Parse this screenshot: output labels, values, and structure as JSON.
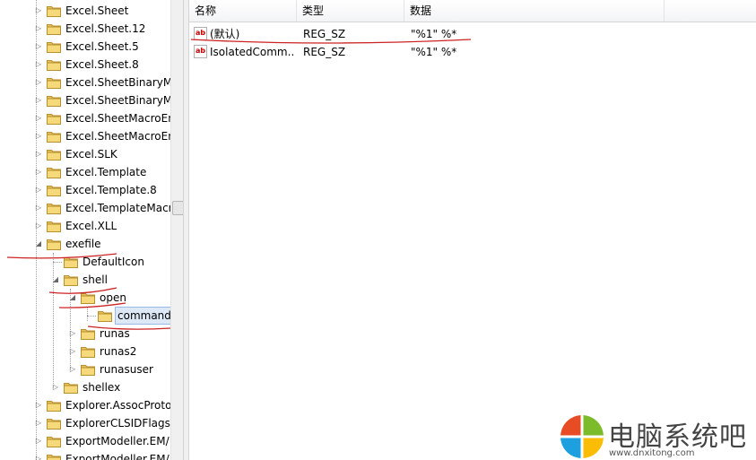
{
  "tree": {
    "items": [
      {
        "label": "Excel.Sheet",
        "level": 0,
        "expander": "closed"
      },
      {
        "label": "Excel.Sheet.12",
        "level": 0,
        "expander": "closed"
      },
      {
        "label": "Excel.Sheet.5",
        "level": 0,
        "expander": "closed"
      },
      {
        "label": "Excel.Sheet.8",
        "level": 0,
        "expander": "closed"
      },
      {
        "label": "Excel.SheetBinaryMa",
        "level": 0,
        "expander": "closed"
      },
      {
        "label": "Excel.SheetBinaryMa",
        "level": 0,
        "expander": "closed"
      },
      {
        "label": "Excel.SheetMacroEn",
        "level": 0,
        "expander": "closed"
      },
      {
        "label": "Excel.SheetMacroEn",
        "level": 0,
        "expander": "closed"
      },
      {
        "label": "Excel.SLK",
        "level": 0,
        "expander": "closed"
      },
      {
        "label": "Excel.Template",
        "level": 0,
        "expander": "closed"
      },
      {
        "label": "Excel.Template.8",
        "level": 0,
        "expander": "closed"
      },
      {
        "label": "Excel.TemplateMacr",
        "level": 0,
        "expander": "closed"
      },
      {
        "label": "Excel.XLL",
        "level": 0,
        "expander": "closed"
      },
      {
        "label": "exefile",
        "level": 0,
        "expander": "open"
      },
      {
        "label": "DefaultIcon",
        "level": 1,
        "expander": "none"
      },
      {
        "label": "shell",
        "level": 1,
        "expander": "open"
      },
      {
        "label": "open",
        "level": 2,
        "expander": "open"
      },
      {
        "label": "command",
        "level": 3,
        "expander": "none",
        "selected": true
      },
      {
        "label": "runas",
        "level": 2,
        "expander": "closed"
      },
      {
        "label": "runas2",
        "level": 2,
        "expander": "closed"
      },
      {
        "label": "runasuser",
        "level": 2,
        "expander": "closed"
      },
      {
        "label": "shellex",
        "level": 1,
        "expander": "closed"
      },
      {
        "label": "Explorer.AssocProto",
        "level": 0,
        "expander": "closed"
      },
      {
        "label": "ExplorerCLSIDFlags",
        "level": 0,
        "expander": "closed"
      },
      {
        "label": "ExportModeller.EM/",
        "level": 0,
        "expander": "closed"
      },
      {
        "label": "ExportModeller.EM/",
        "level": 0,
        "expander": "closed"
      }
    ]
  },
  "list": {
    "columns": [
      "名称",
      "类型",
      "数据"
    ],
    "rows": [
      {
        "name": "(默认)",
        "type": "REG_SZ",
        "data": "\"%1\" %*"
      },
      {
        "name": "IsolatedComm...",
        "type": "REG_SZ",
        "data": "\"%1\" %*"
      }
    ]
  },
  "watermark": {
    "brand": "电脑系统吧",
    "url": "www.dnxitong.com"
  },
  "colors": {
    "annotation_red": "#cc2222",
    "folder_yellow": "#e8c25a",
    "selection_bg": "#dde8f7"
  },
  "icons": {
    "tree_node": "folder-icon",
    "string_value": "reg-sz-ab-icon",
    "brand_logo": "windows-logo-icon"
  }
}
